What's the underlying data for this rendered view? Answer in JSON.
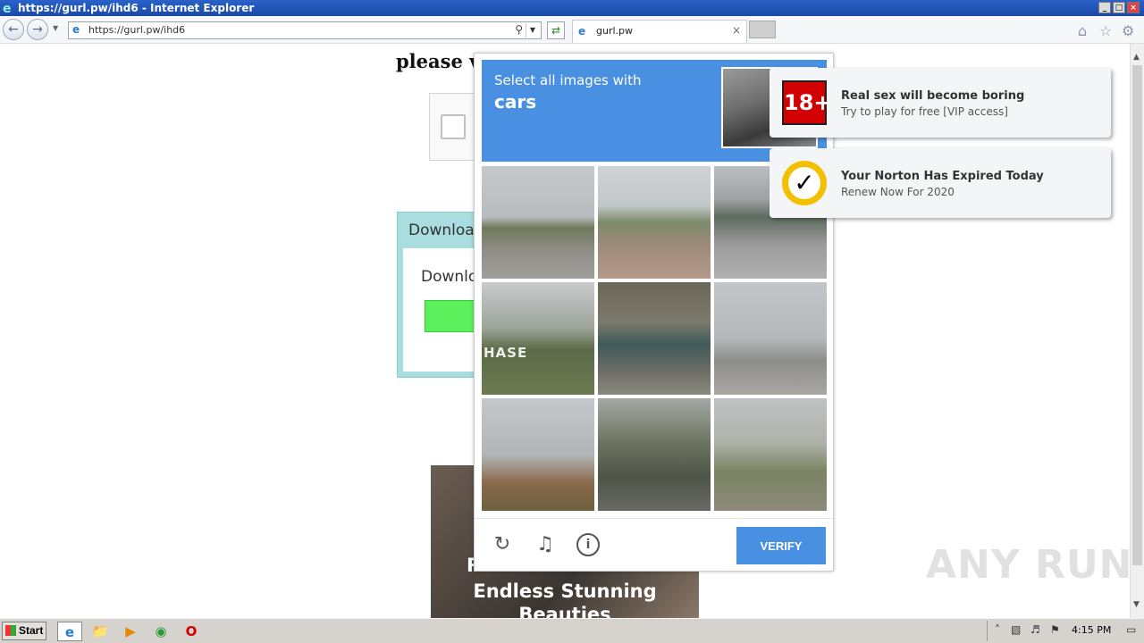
{
  "window": {
    "title": "https://gurl.pw/ihd6 - Internet Explorer",
    "minimize": "_",
    "maximize": "□",
    "close": "×"
  },
  "browser": {
    "url": "https://gurl.pw/ihd6",
    "tab_label": "gurl.pw",
    "tab_close": "×"
  },
  "page": {
    "heading": "please ve",
    "download_title": "Download",
    "download_text": "Downlo",
    "promo_line1": "R",
    "promo_line2": "Endless Stunning Beauties"
  },
  "captcha": {
    "instruction": "Select all images with",
    "object": "cars",
    "verify_label": "VERIFY",
    "tiles": [
      {
        "id": 1
      },
      {
        "id": 2
      },
      {
        "id": 3
      },
      {
        "id": 4,
        "sign_text": "HASE"
      },
      {
        "id": 5
      },
      {
        "id": 6
      },
      {
        "id": 7
      },
      {
        "id": 8
      },
      {
        "id": 9
      }
    ]
  },
  "notifications": [
    {
      "icon": "18+",
      "title": "Real sex will become boring",
      "subtitle": "Try to play for free [VIP access]"
    },
    {
      "icon": "norton-check",
      "title": "Your Norton Has Expired Today",
      "subtitle": "Renew Now For 2020"
    }
  ],
  "watermark": "ANY RUN",
  "taskbar": {
    "start_label": "Start",
    "clock": "4:15 PM"
  },
  "colors": {
    "accent": "#4a90e2",
    "badge_red": "#d20000",
    "norton_yellow": "#f2c000",
    "progress_green": "#5cf05c"
  }
}
